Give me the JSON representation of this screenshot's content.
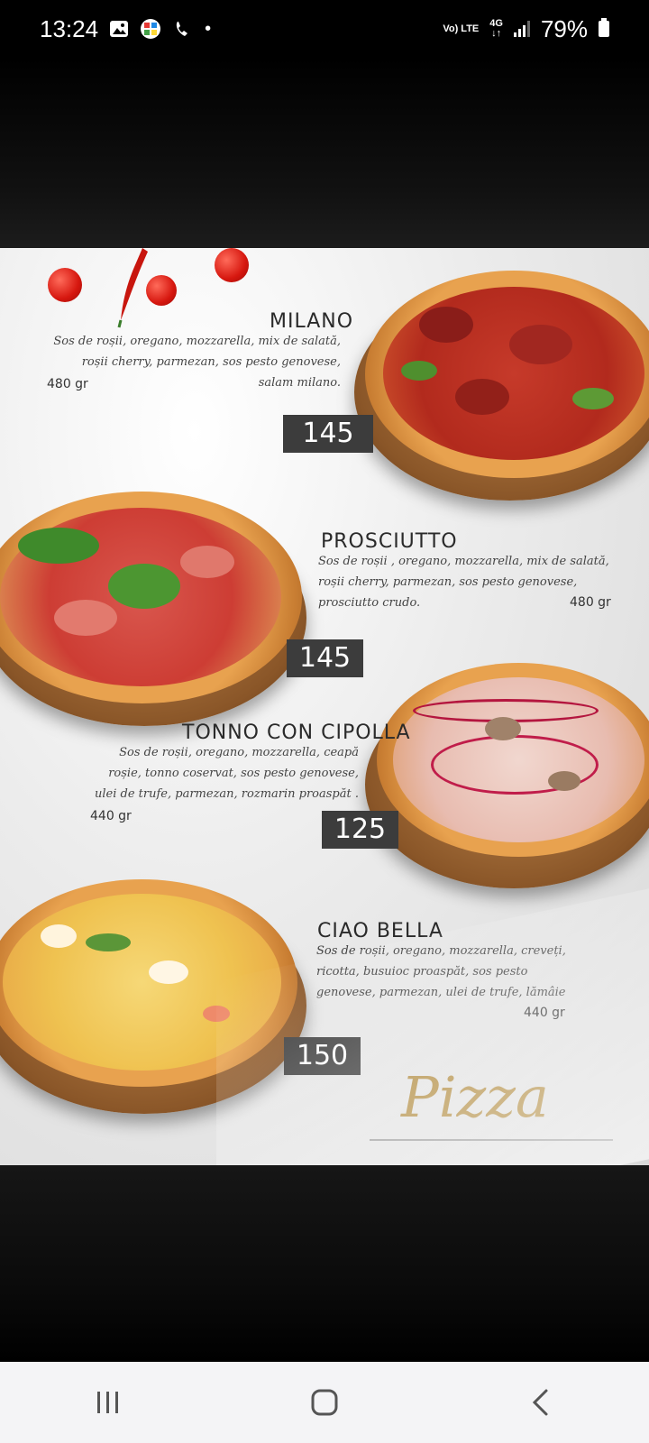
{
  "status": {
    "time": "13:24",
    "network": "Vo) LTE",
    "mobile_data": "4G",
    "battery": "79%"
  },
  "menu": {
    "items": [
      {
        "name": "MILANO",
        "description": "Sos de roșii, oregano, mozzarella, mix de salată, roșii cherry, parmezan, sos pesto genovese, salam milano.",
        "weight": "480 gr",
        "price": "145"
      },
      {
        "name": "PROSCIUTTO",
        "description": "Sos de roșii , oregano, mozzarella, mix de salată, roșii cherry, parmezan, sos pesto genovese, prosciutto crudo.",
        "weight": "480 gr",
        "price": "145"
      },
      {
        "name": "TONNO CON CIPOLLA",
        "description": "Sos de roșii, oregano, mozzarella, ceapă roșie, tonno coservat, sos pesto genovese, ulei de trufe, parmezan, rozmarin proaspăt .",
        "weight": "440 gr",
        "price": "125"
      },
      {
        "name": "CIAO BELLA",
        "description": "Sos de roșii, oregano, mozzarella, creveți, ricotta, busuioc proaspăt, sos pesto genovese, parmezan, ulei de trufe, lămâie",
        "weight": "440 gr",
        "price": "150"
      }
    ],
    "section_title": "Pizza"
  },
  "navigation": {
    "recent_icon": "recent-apps-icon",
    "home_icon": "home-icon",
    "back_icon": "back-icon"
  }
}
